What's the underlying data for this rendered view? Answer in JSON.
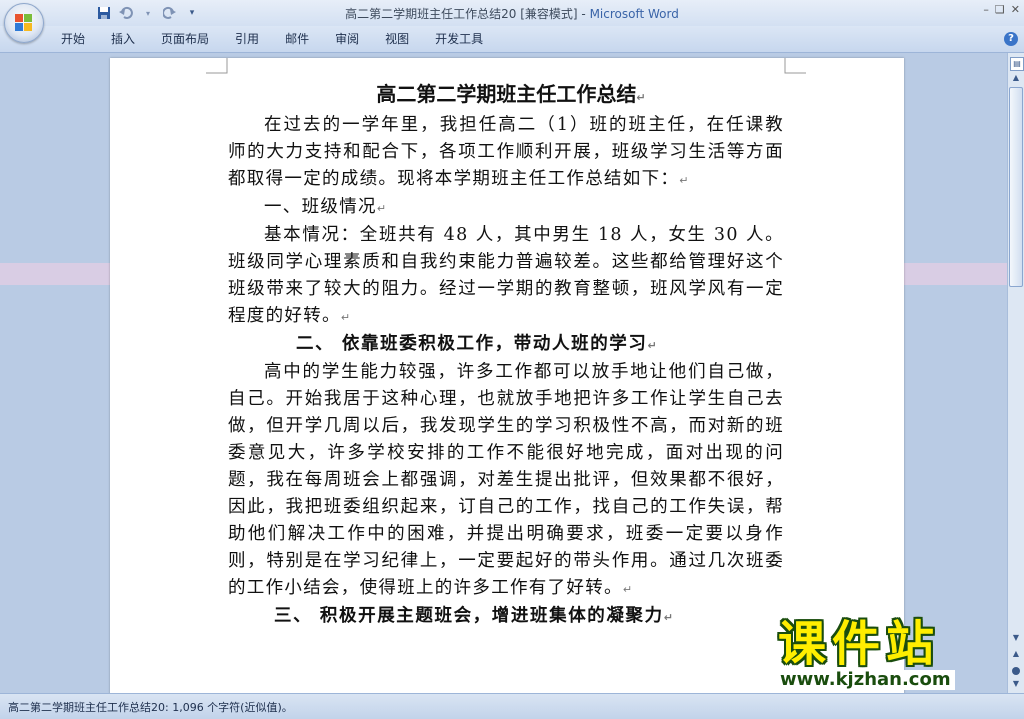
{
  "window": {
    "doc_title": "高二第二学期班主任工作总结20 [兼容模式]",
    "separator": " - ",
    "app_name": "Microsoft Word"
  },
  "qat": {
    "save_icon": "save-icon",
    "undo_icon": "undo-icon",
    "redo_icon": "redo-icon",
    "customize_icon": "customize-qat-icon"
  },
  "ribbon": {
    "tabs": [
      {
        "label": "开始"
      },
      {
        "label": "插入"
      },
      {
        "label": "页面布局"
      },
      {
        "label": "引用"
      },
      {
        "label": "邮件"
      },
      {
        "label": "审阅"
      },
      {
        "label": "视图"
      },
      {
        "label": "开发工具"
      }
    ],
    "help_label": "?"
  },
  "document": {
    "title": "高二第二学期班主任工作总结",
    "paragraphs": [
      "在过去的一学年里，我担任高二（1）班的班主任，在任课教师的大力支持和配合下，各项工作顺利开展，班级学习生活等方面都取得一定的成绩。现将本学期班主任工作总结如下：",
      "一、班级情况",
      "基本情况：全班共有 48 人，其中男生 18 人，女生 30 人。班级同学心理素质和自我约束能力普遍较差。这些都给管理好这个班级带来了较大的阻力。经过一学期的教育整顿，班风学风有一定程度的好转。",
      "二、 依靠班委积极工作，带动人班的学习",
      "高中的学生能力较强，许多工作都可以放手地让他们自己做，自己。开始我居于这种心理，也就放手地把许多工作让学生自己去做，但开学几周以后，我发现学生的学习积极性不高，而对新的班委意见大，许多学校安排的工作不能很好地完成，面对出现的问题，我在每周班会上都强调，对差生提出批评，但效果都不很好，因此，我把班委组织起来，订自己的工作，找自己的工作失误，帮助他们解决工作中的困难，并提出明确要求，班委一定要以身作则，特别是在学习纪律上，一定要起好的带头作用。通过几次班委的工作小结会，使得班上的许多工作有了好转。",
      "三、 积极开展主题班会，增进班集体的凝聚力"
    ],
    "para_mark": "↵"
  },
  "status": {
    "text": "高二第二学期班主任工作总结20: 1,096 个字符(近似值)。"
  },
  "watermark": {
    "chinese": "课件站",
    "url": "www.kjzhan.com"
  },
  "colors": {
    "app_name": "#3a64a8",
    "workspace": "#b9cbe4",
    "watermark_fill": "#ffee00",
    "watermark_outline": "#1a4d0e"
  }
}
